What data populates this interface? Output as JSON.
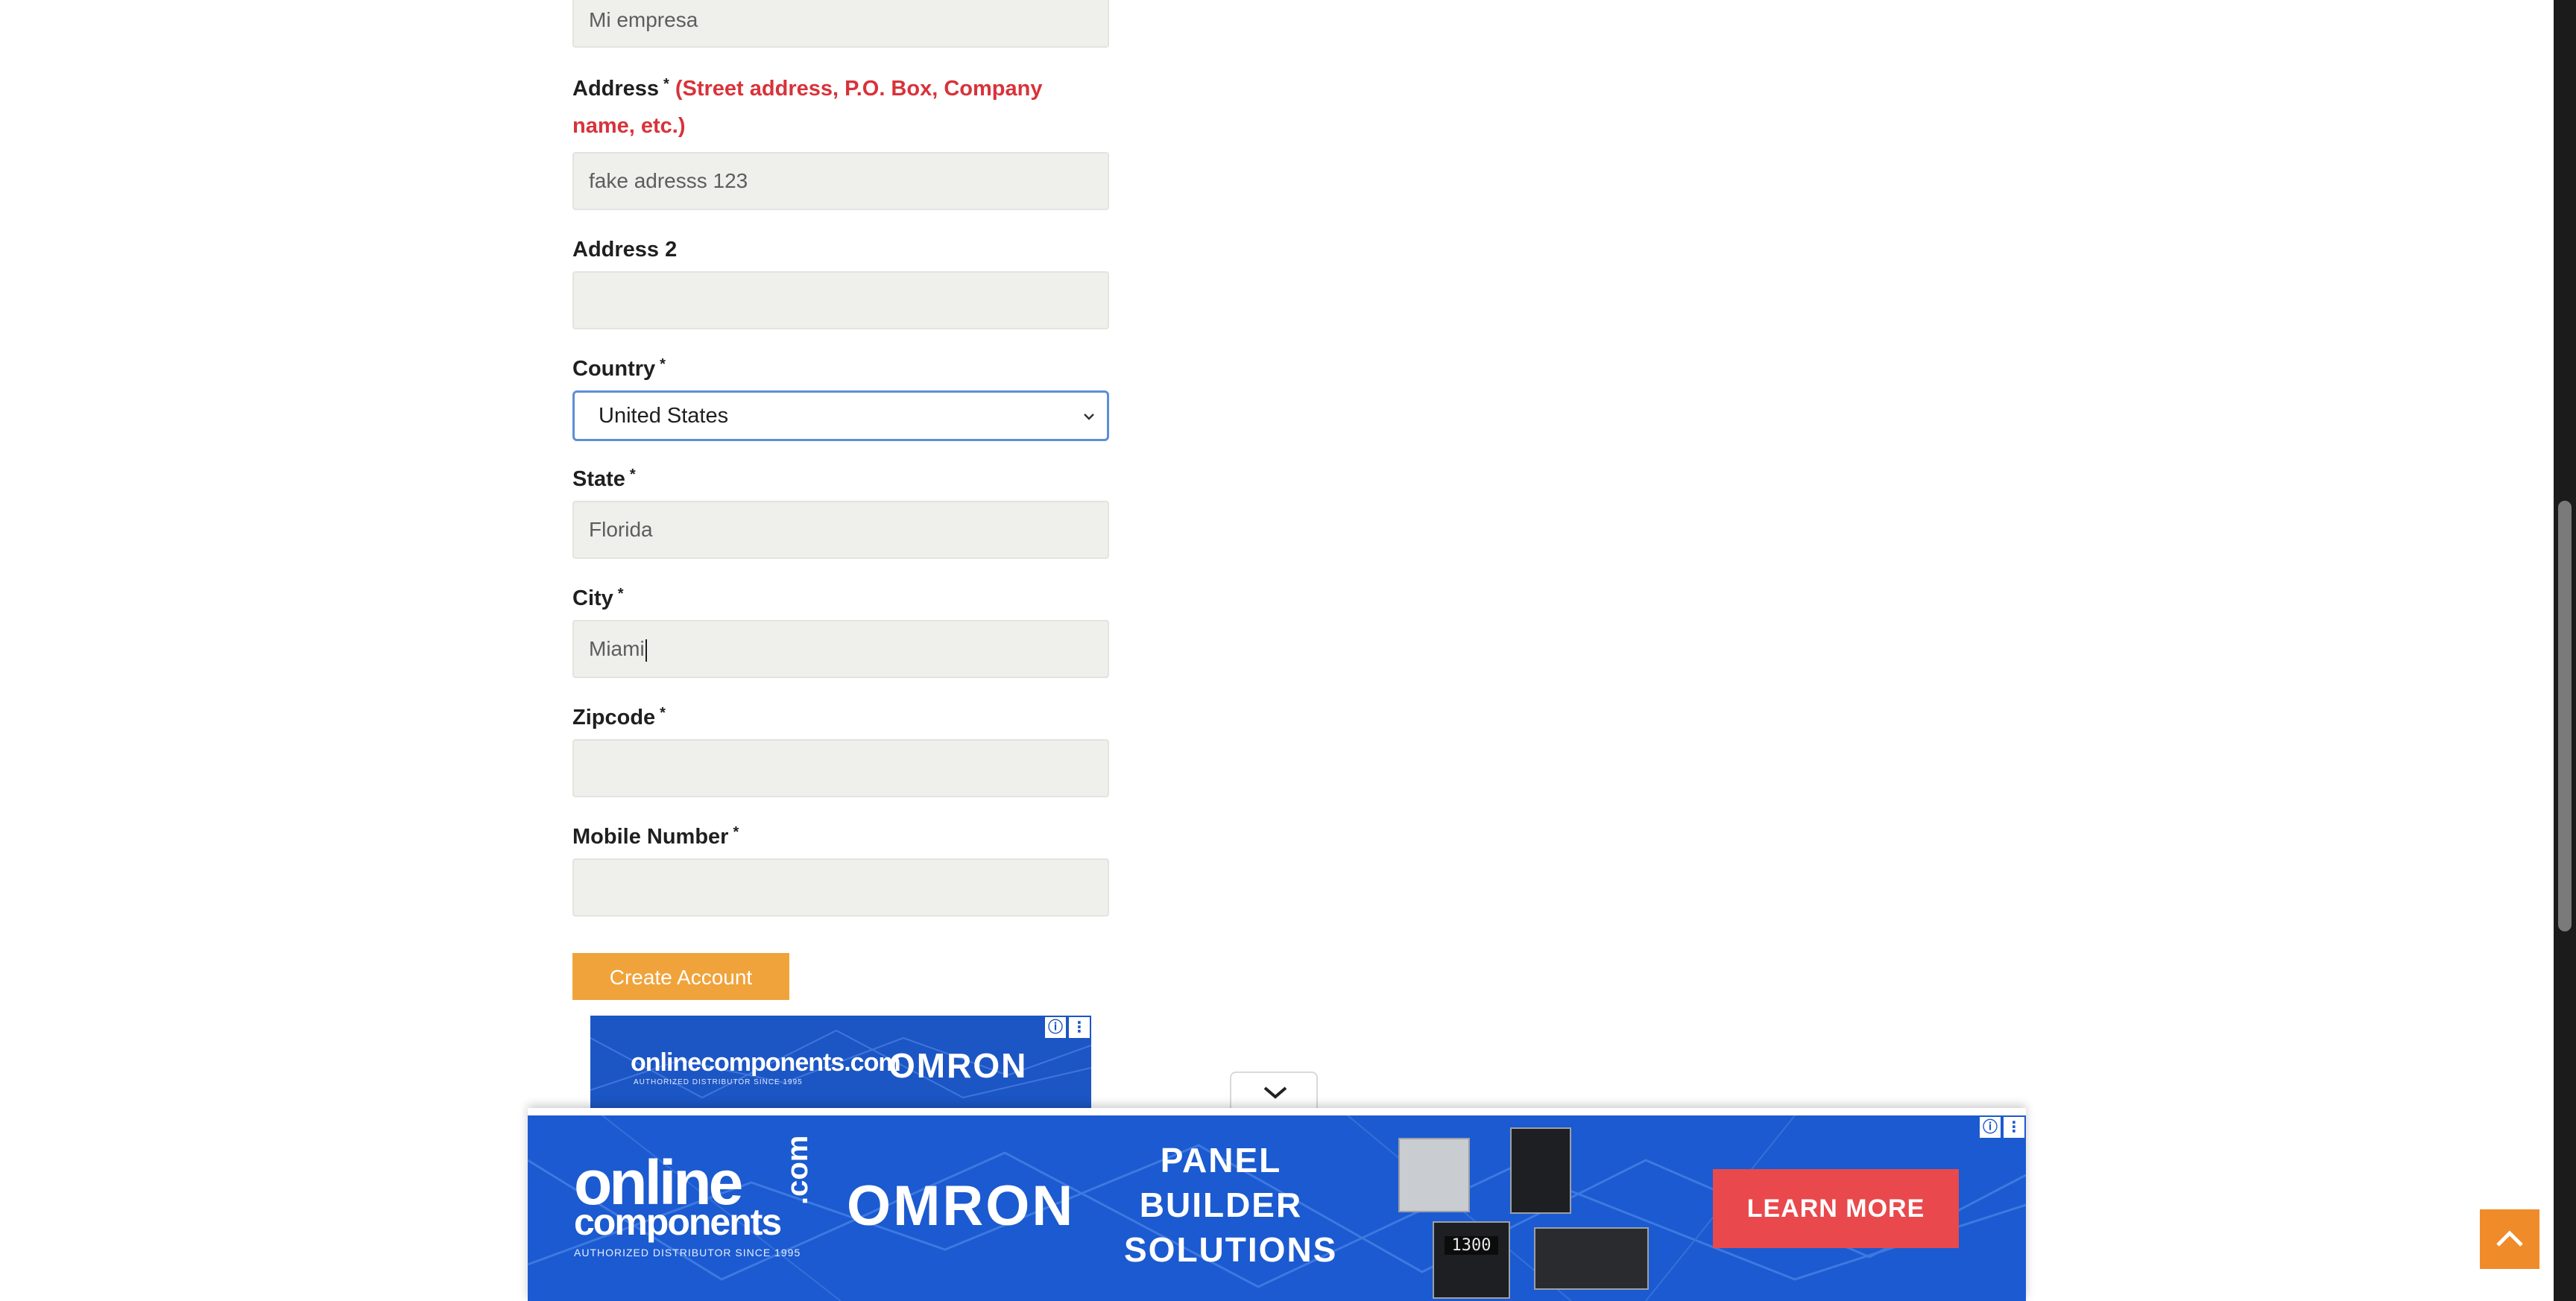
{
  "form": {
    "company_value": "Mi empresa",
    "address_label": "Address",
    "address_hint": "(Street address, P.O. Box, Company name, etc.)",
    "address_value": "fake adresss 123",
    "address2_label": "Address 2",
    "address2_value": "",
    "country_label": "Country",
    "country_value": "United States",
    "state_label": "State",
    "state_value": "Florida",
    "city_label": "City",
    "city_value": "Miami",
    "zipcode_label": "Zipcode",
    "zipcode_value": "",
    "mobile_label": "Mobile Number",
    "mobile_value": "",
    "required_mark": "*",
    "submit_label": "Create Account"
  },
  "ad_small": {
    "brand": "onlinecomponents.com",
    "tagline": "AUTHORIZED DISTRIBUTOR SINCE 1995",
    "partner": "OMRON"
  },
  "ad_banner": {
    "brand_line1": "online",
    "brand_line2": "components",
    "brand_suffix": ".com",
    "tagline": "AUTHORIZED DISTRIBUTOR SINCE 1995",
    "partner": "OMRON",
    "headline": [
      "PANEL",
      "BUILDER",
      "SOLUTIONS"
    ],
    "cta": "LEARN MORE",
    "info_icon": "info-icon",
    "menu_icon": "kebab-menu-icon",
    "display_readout": "1300"
  },
  "colors": {
    "accent": "#f0a33a",
    "required_hint": "#d9323a",
    "focus_border": "#5c8fd6",
    "ad_blue": "#1b5ad0",
    "cta_red": "#e9494c",
    "to_top": "#f08b2a"
  }
}
